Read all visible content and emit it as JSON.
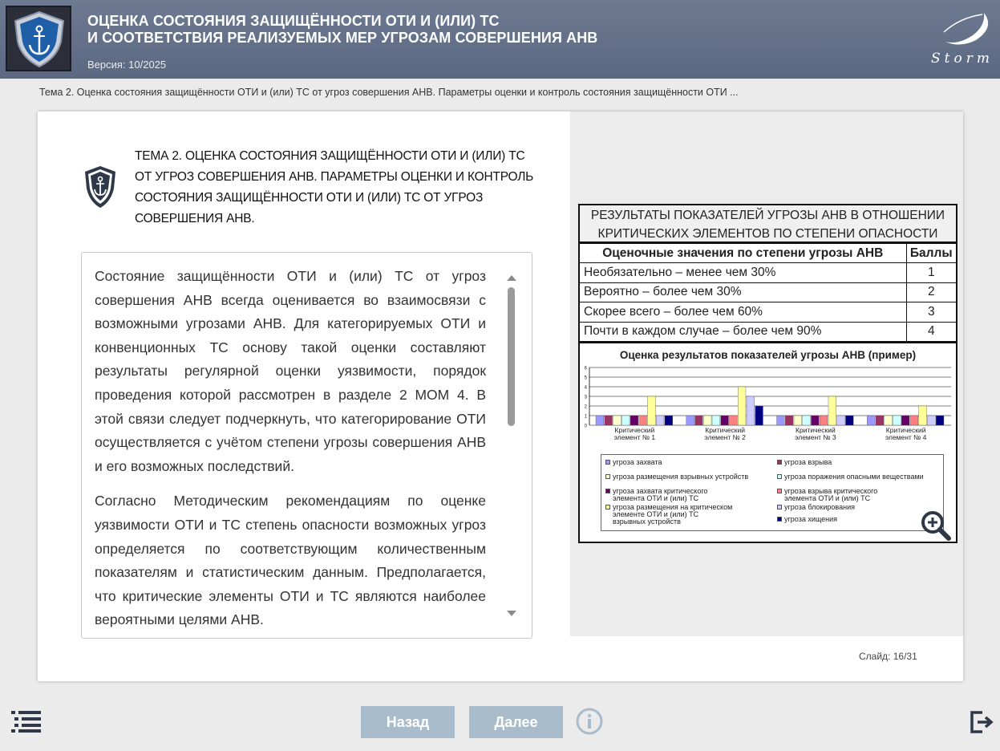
{
  "header": {
    "title_line1": "ОЦЕНКА СОСТОЯНИЯ ЗАЩИЩЁННОСТИ ОТИ И (ИЛИ) ТС",
    "title_line2": "И СООТВЕТСТВИЯ РЕАЛИЗУЕМЫХ МЕР УГРОЗАМ СОВЕРШЕНИЯ АНВ",
    "version": "Версия: 10/2025",
    "brand": "Storm"
  },
  "breadcrumb": "Тема 2. Оценка состояния защищённости ОТИ и (или) ТС от угроз совершения АНВ. Параметры оценки и контроль состояния защищённости ОТИ ...",
  "topic": {
    "title": "ТЕМА 2. ОЦЕНКА СОСТОЯНИЯ ЗАЩИЩЁННОСТИ ОТИ И (ИЛИ) ТС ОТ УГРОЗ СОВЕРШЕНИЯ АНВ. ПАРАМЕТРЫ ОЦЕНКИ И КОНТРОЛЬ СОСТОЯНИЯ ЗАЩИЩЁННОСТИ ОТИ И (ИЛИ) ТС ОТ УГРОЗ СОВЕРШЕНИЯ АНВ."
  },
  "body": {
    "paragraph1": "Состояние защищённости ОТИ и (или) ТС от угроз совершения АНВ всегда оценивается во взаимосвязи с возможными угрозами АНВ. Для категорируемых ОТИ и конвенционных ТС основу такой оценки составляют результаты регулярной оценки уязвимости, порядок проведения которой рассмотрен в разделе 2 МОМ 4. В этой связи следует подчеркнуть, что категорирование ОТИ осуществляется с учётом степени угрозы совершения АНВ и его возможных последствий.",
    "paragraph2": "Согласно Методическим рекомендациям по оценке уязвимости ОТИ и ТС степень опасности возможных угроз определяется по соответствующим количественным показателям и статистическим данным. Предполагается, что критические элементы ОТИ и ТС являются наиболее вероятными целями АНВ."
  },
  "results": {
    "title": "РЕЗУЛЬТАТЫ ПОКАЗАТЕЛЕЙ УГРОЗЫ АНВ В ОТНОШЕНИИ КРИТИЧЕСКИХ ЭЛЕМЕНТОВ ПО СТЕПЕНИ ОПАСНОСТИ",
    "col_header_1": "Оценочные значения по степени угрозы АНВ",
    "col_header_2": "Баллы",
    "rows": [
      {
        "label": "Необязательно – менее чем 30%",
        "score": "1"
      },
      {
        "label": "Вероятно – более чем 30%",
        "score": "2"
      },
      {
        "label": "Скорее всего – более чем 60%",
        "score": "3"
      },
      {
        "label": "Почти в каждом случае – более чем 90%",
        "score": "4"
      }
    ]
  },
  "chart_data": {
    "type": "bar",
    "title": "Оценка результатов показателей угрозы АНВ (пример)",
    "categories": [
      "Критический элемент № 1",
      "Критический элемент № 2",
      "Критический элемент № 3",
      "Критический элемент № 4"
    ],
    "ylim": [
      0,
      6
    ],
    "yticks": [
      0,
      1,
      2,
      3,
      4,
      5,
      6
    ],
    "grid": true,
    "legend_placement": "bottom",
    "series": [
      {
        "name": "угроза захвата",
        "color": "#9999ff",
        "values": [
          1,
          1,
          1,
          1
        ]
      },
      {
        "name": "угроза взрыва",
        "color": "#993366",
        "values": [
          1,
          1,
          1,
          1
        ]
      },
      {
        "name": "угроза размещения взрывных устройств",
        "color": "#ffffcc",
        "values": [
          1,
          1,
          1,
          1
        ]
      },
      {
        "name": "угроза поражения опасными веществами",
        "color": "#ccffff",
        "values": [
          1,
          1,
          1,
          1
        ]
      },
      {
        "name": "угроза захвата критического элемента ОТИ и (или) ТС",
        "color": "#660066",
        "values": [
          1,
          1,
          1,
          1
        ]
      },
      {
        "name": "угроза взрыва критического элемента ОТИ и (или) ТС",
        "color": "#ff8080",
        "values": [
          1,
          1,
          1,
          1
        ]
      },
      {
        "name": "угроза размещения на критическом элементе ОТИ и (или) ТС взрывных устройств",
        "color": "#ffff99",
        "values": [
          3,
          4,
          3,
          2
        ]
      },
      {
        "name": "угроза блокирования",
        "color": "#ccccff",
        "values": [
          1,
          3,
          1,
          1
        ]
      },
      {
        "name": "угроза хищения",
        "color": "#000080",
        "values": [
          1,
          2,
          1,
          1
        ]
      }
    ]
  },
  "slide": {
    "label": "Слайд:",
    "current": "16",
    "total": "31",
    "counter": "16/31"
  },
  "nav": {
    "back_label": "Назад",
    "next_label": "Далее"
  },
  "icons": {
    "logo": "anchor-shield-icon",
    "topic": "shield-anchor-icon",
    "zoom": "zoom-in-icon",
    "menu": "menu-list-icon",
    "info": "info-icon",
    "exit": "exit-icon"
  }
}
